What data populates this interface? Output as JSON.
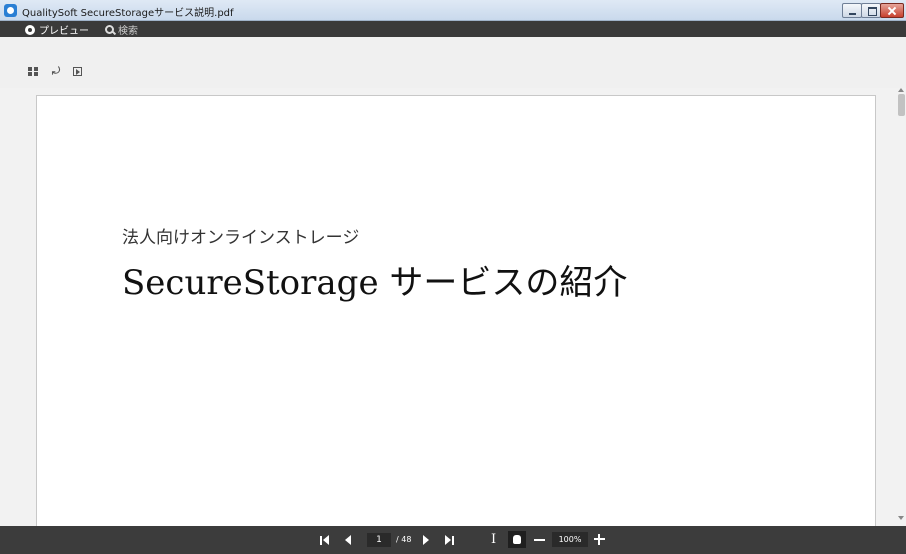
{
  "window": {
    "title": "QualitySoft SecureStorageサービス説明.pdf"
  },
  "menu": {
    "preview_label": "プレビュー",
    "search_label": "検索"
  },
  "toolbar": {
    "icons": [
      "grid-view-icon",
      "rotate-icon",
      "fit-page-icon"
    ]
  },
  "document": {
    "subtitle": "法人向けオンラインストレージ",
    "title": "SecureStorage サービスの紹介"
  },
  "navigation": {
    "current_page": "1",
    "total_pages": "/ 48",
    "zoom": "100%"
  },
  "colors": {
    "bar_background": "#3c3c3c",
    "page_background": "#ffffff",
    "close_button": "#c7402e"
  }
}
